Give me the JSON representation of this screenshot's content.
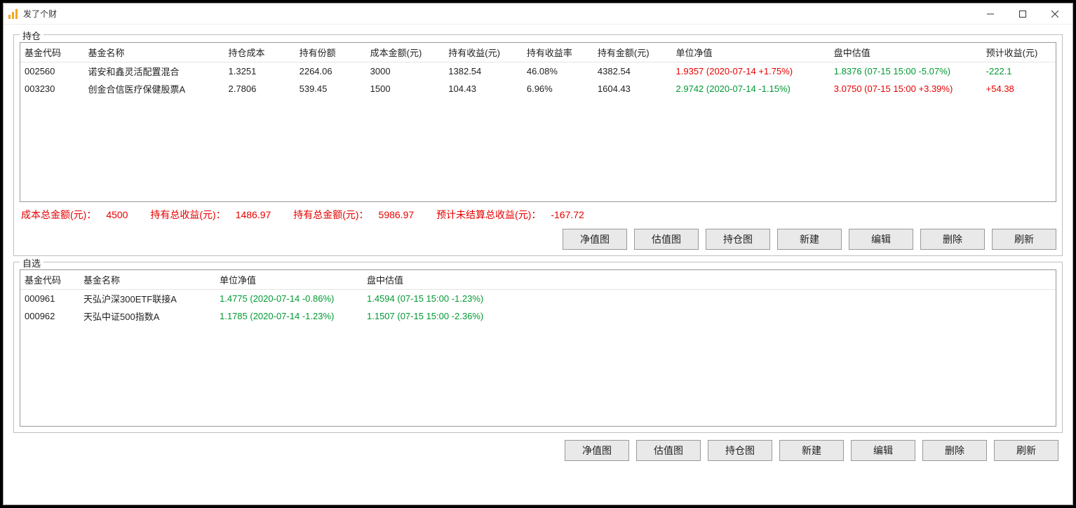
{
  "window": {
    "title": "发了个财"
  },
  "holdings": {
    "label": "持仓",
    "headers": [
      "基金代码",
      "基金名称",
      "持仓成本",
      "持有份额",
      "成本金额(元)",
      "持有收益(元)",
      "持有收益率",
      "持有金额(元)",
      "单位净值",
      "盘中估值",
      "预计收益(元)"
    ],
    "rows": [
      {
        "code": "002560",
        "name": "诺安和鑫灵活配置混合",
        "cost": "1.3251",
        "shares": "2264.06",
        "cost_amt": "3000",
        "gain": "1382.54",
        "rate": "46.08%",
        "hold_amt": "4382.54",
        "nav": "1.9357 (2020-07-14  +1.75%)",
        "nav_color": "red",
        "est": "1.8376 (07-15 15:00  -5.07%)",
        "est_color": "green",
        "forecast": "-222.1",
        "forecast_color": "green"
      },
      {
        "code": "003230",
        "name": "创金合信医疗保健股票A",
        "cost": "2.7806",
        "shares": "539.45",
        "cost_amt": "1500",
        "gain": "104.43",
        "rate": "6.96%",
        "hold_amt": "1604.43",
        "nav": "2.9742 (2020-07-14  -1.15%)",
        "nav_color": "green",
        "est": "3.0750 (07-15 15:00  +3.39%)",
        "est_color": "red",
        "forecast": "+54.38",
        "forecast_color": "red"
      }
    ],
    "summary": {
      "l1": "成本总金额(元)：",
      "v1": "4500",
      "l2": "持有总收益(元)：",
      "v2": "1486.97",
      "l3": "持有总金额(元)：",
      "v3": "5986.97",
      "l4": "预计未结算总收益(元)：",
      "v4": "-167.72"
    },
    "buttons": [
      "净值图",
      "估值图",
      "持仓图",
      "新建",
      "编辑",
      "删除",
      "刷新"
    ]
  },
  "watchlist": {
    "label": "自选",
    "headers": [
      "基金代码",
      "基金名称",
      "单位净值",
      "盘中估值"
    ],
    "rows": [
      {
        "code": "000961",
        "name": "天弘沪深300ETF联接A",
        "nav": "1.4775 (2020-07-14  -0.86%)",
        "nav_color": "green",
        "est": "1.4594 (07-15 15:00  -1.23%)",
        "est_color": "green"
      },
      {
        "code": "000962",
        "name": "天弘中证500指数A",
        "nav": "1.1785 (2020-07-14  -1.23%)",
        "nav_color": "green",
        "est": "1.1507 (07-15 15:00  -2.36%)",
        "est_color": "green"
      }
    ],
    "buttons": [
      "净值图",
      "估值图",
      "持仓图",
      "新建",
      "编辑",
      "删除",
      "刷新"
    ]
  }
}
